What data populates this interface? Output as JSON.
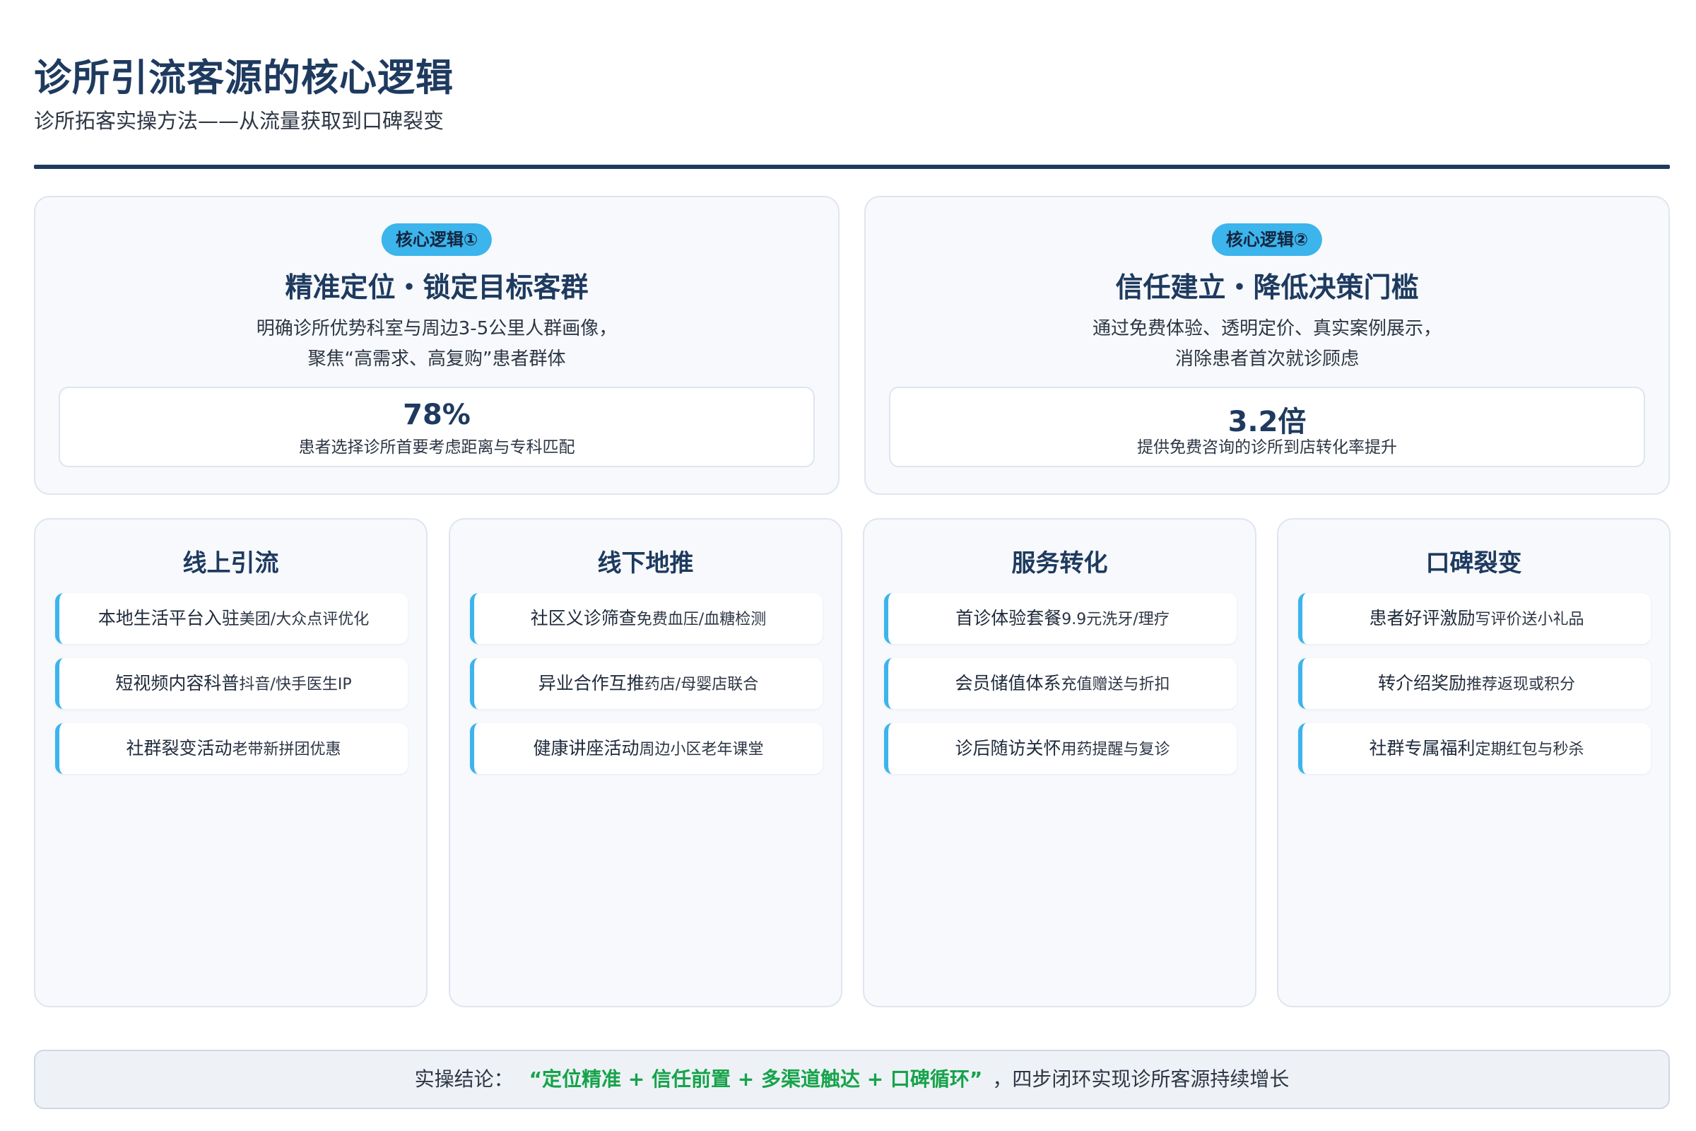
{
  "header": {
    "title": "诊所引流客源的核心逻辑",
    "subtitle": "诊所拓客实操方法——从流量获取到口碑裂变"
  },
  "logic_cards": [
    {
      "badge": "核心逻辑①",
      "heading": "精准定位・锁定目标客群",
      "desc_line1": "明确诊所优势科室与周边3-5公里人群画像，",
      "desc_line2": "聚焦“高需求、高复购”患者群体",
      "stat_value": "78%",
      "stat_label": "患者选择诊所首要考虑距离与专科匹配"
    },
    {
      "badge": "核心逻辑②",
      "heading": "信任建立・降低决策门槛",
      "desc_line1": "通过免费体验、透明定价、真实案例展示，",
      "desc_line2": "消除患者首次就诊顾虑",
      "stat_value": "3.2倍",
      "stat_label": "提供免费咨询的诊所到店转化率提升"
    }
  ],
  "channels": [
    {
      "title": "线上引流",
      "items": [
        {
          "main": "本地生活平台入驻",
          "detail": "美团/大众点评优化"
        },
        {
          "main": "短视频内容科普",
          "detail": "抖音/快手医生IP"
        },
        {
          "main": "社群裂变活动",
          "detail": "老带新拼团优惠"
        }
      ]
    },
    {
      "title": "线下地推",
      "items": [
        {
          "main": "社区义诊筛查",
          "detail": "免费血压/血糖检测"
        },
        {
          "main": "异业合作互推",
          "detail": "药店/母婴店联合"
        },
        {
          "main": "健康讲座活动",
          "detail": "周边小区老年课堂"
        }
      ]
    },
    {
      "title": "服务转化",
      "items": [
        {
          "main": "首诊体验套餐",
          "detail": "9.9元洗牙/理疗"
        },
        {
          "main": "会员储值体系",
          "detail": "充值赠送与折扣"
        },
        {
          "main": "诊后随访关怀",
          "detail": "用药提醒与复诊"
        }
      ]
    },
    {
      "title": "口碑裂变",
      "items": [
        {
          "main": "患者好评激励",
          "detail": "写评价送小礼品"
        },
        {
          "main": "转介绍奖励",
          "detail": "推荐返现或积分"
        },
        {
          "main": "社群专属福利",
          "detail": "定期红包与秒杀"
        }
      ]
    }
  ],
  "conclusion": {
    "prefix": "实操结论：",
    "highlight": "“定位精准 + 信任前置 + 多渠道触达 + 口碑循环”",
    "suffix": "，四步闭环实现诊所客源持续增长"
  },
  "colors": {
    "primary": "#1e3a5f",
    "accent": "#3cb4ec",
    "highlight": "#16a34a",
    "card_bg": "#f7f9fc"
  }
}
